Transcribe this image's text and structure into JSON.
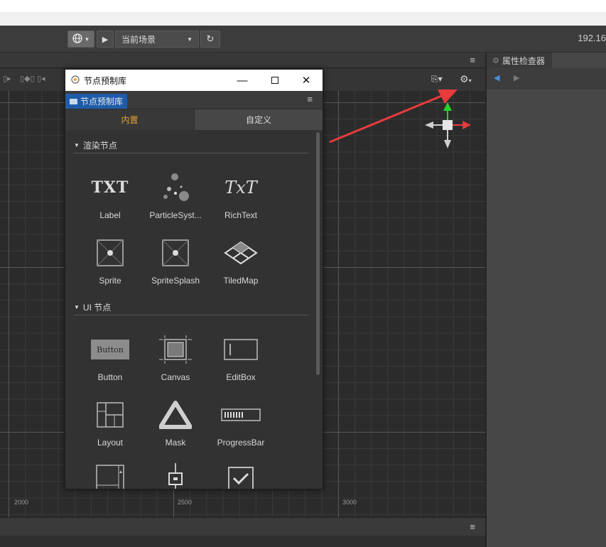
{
  "toolbar": {
    "scene_label": "当前场景",
    "ip": "192.16"
  },
  "inspector": {
    "tab_label": "属性检查器"
  },
  "ruler": {
    "labels": [
      "2000",
      "2500",
      "3000"
    ]
  },
  "dialog": {
    "title": "节点预制库",
    "tag_label": "节点预制库",
    "tabs": [
      {
        "label": "内置",
        "active": true
      },
      {
        "label": "自定义",
        "active": false
      }
    ],
    "sections": [
      {
        "label": "渲染节点",
        "items": [
          {
            "name": "Label",
            "icon_text": "TXT"
          },
          {
            "name": "ParticleSyst..."
          },
          {
            "name": "RichText",
            "icon_text": "TxT"
          },
          {
            "name": "Sprite"
          },
          {
            "name": "SpriteSplash"
          },
          {
            "name": "TiledMap"
          }
        ]
      },
      {
        "label": "UI 节点",
        "items": [
          {
            "name": "Button",
            "icon_text": "Button"
          },
          {
            "name": "Canvas"
          },
          {
            "name": "EditBox"
          },
          {
            "name": "Layout"
          },
          {
            "name": "Mask"
          },
          {
            "name": "ProgressBar"
          }
        ]
      }
    ]
  },
  "colors": {
    "accent_orange": "#e8a236",
    "tag_blue": "#1f5ca8",
    "arrow_red": "#e83b3b"
  }
}
